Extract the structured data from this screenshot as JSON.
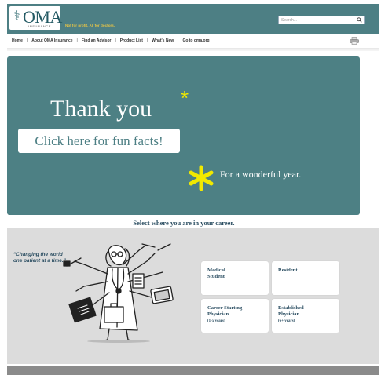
{
  "header": {
    "logo_text": "OMA",
    "logo_sub": "INSURANCE",
    "tagline": "Not for profit. All for doctors.",
    "search_placeholder": "Search..."
  },
  "nav": {
    "items": [
      "Home",
      "About OMA Insurance",
      "Find an Advisor",
      "Product List",
      "What's New",
      "Go to oma.org"
    ],
    "separator": "|"
  },
  "banner": {
    "title": "Thank you",
    "asterisk": "*",
    "button_label": "Click here for fun facts!",
    "footnote": "For a wonderful year."
  },
  "career": {
    "heading": "Select where you are in your career.",
    "quote_line1": "“Changing the world",
    "quote_line2": "one patient at a time.”",
    "cards": [
      {
        "line1": "Medical",
        "line2": "Student",
        "sub": ""
      },
      {
        "line1": "Resident",
        "line2": "",
        "sub": ""
      },
      {
        "line1": "Career Starting",
        "line2": "Physician",
        "sub": "(1-5 years)"
      },
      {
        "line1": "Established",
        "line2": "Physician",
        "sub": "(6+ years)"
      }
    ]
  },
  "colors": {
    "teal": "#4d8084",
    "accent_yellow": "#f1e900",
    "navy_text": "#2a4d61",
    "panel_gray": "#dcdcdc"
  },
  "icons": [
    "search-icon",
    "print-icon",
    "asterisk-icon",
    "doctor-illustration"
  ]
}
